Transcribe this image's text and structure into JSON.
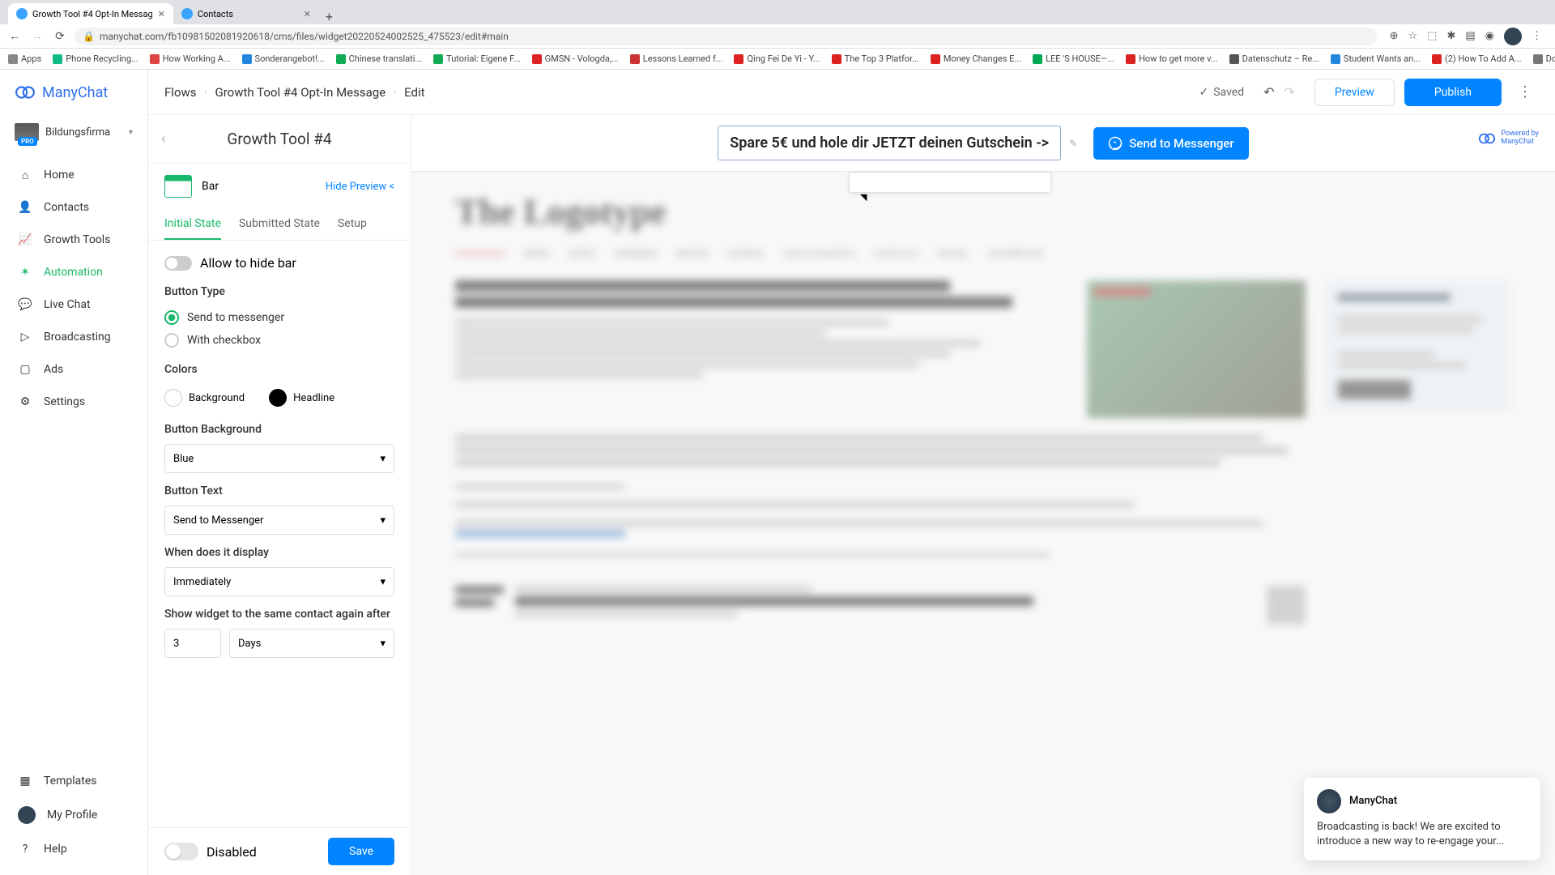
{
  "browser": {
    "tabs": [
      {
        "title": "Growth Tool #4 Opt-In Messag"
      },
      {
        "title": "Contacts"
      }
    ],
    "url": "manychat.com/fb10981502081920618/cms/files/widget20220524002525_475523/edit#main",
    "bookmarks": [
      "Apps",
      "Phone Recycling...",
      "How Working A...",
      "Sonderangebot!...",
      "Chinese translati...",
      "Tutorial: Eigene F...",
      "GMSN - Vologda,...",
      "Lessons Learned f...",
      "Qing Fei De Yi - Y...",
      "The Top 3 Platfor...",
      "Money Changes E...",
      "LEE 'S HOUSE—...",
      "How to get more v...",
      "Datenschutz – Re...",
      "Student Wants an...",
      "(2) How To Add A...",
      "Download - Cooki..."
    ]
  },
  "app": {
    "brand": "ManyChat",
    "org": {
      "name": "Bildungsfirma",
      "badge": "PRO"
    },
    "nav": [
      "Home",
      "Contacts",
      "Growth Tools",
      "Automation",
      "Live Chat",
      "Broadcasting",
      "Ads",
      "Settings"
    ],
    "navBottom": [
      "Templates",
      "My Profile",
      "Help"
    ]
  },
  "breadcrumbs": [
    "Flows",
    "Growth Tool #4 Opt-In Message",
    "Edit"
  ],
  "topbar": {
    "saved": "Saved",
    "preview": "Preview",
    "publish": "Publish"
  },
  "panel": {
    "title": "Growth Tool #4",
    "barLabel": "Bar",
    "hidePreview": "Hide Preview <",
    "tabs": [
      "Initial State",
      "Submitted State",
      "Setup"
    ],
    "allowHide": "Allow to hide bar",
    "buttonType": {
      "title": "Button Type",
      "opts": [
        "Send to messenger",
        "With checkbox"
      ]
    },
    "colors": {
      "title": "Colors",
      "bg": "Background",
      "hl": "Headline"
    },
    "buttonBg": {
      "title": "Button Background",
      "value": "Blue"
    },
    "buttonText": {
      "title": "Button Text",
      "value": "Send to Messenger"
    },
    "whenDisplay": {
      "title": "When does it display",
      "value": "Immediately"
    },
    "showAgain": {
      "title": "Show widget to the same contact again after",
      "num": "3",
      "unit": "Days"
    },
    "disabled": "Disabled",
    "save": "Save"
  },
  "previewBar": {
    "text": "Spare 5€ und hole dir JETZT deinen Gutschein ->",
    "button": "Send to Messenger",
    "powered": "Powered by\nManyChat"
  },
  "blurSite": {
    "masthead": "The Logotype",
    "nav": [
      "FRONTPAGE",
      "NEWS",
      "SPORT",
      "BUSINESS",
      "MOVIES",
      "SCIENCE",
      "TECH & GADGETS",
      "LIFESTYLE",
      "TRAVEL",
      "AUTOMOTIVE"
    ]
  },
  "chat": {
    "name": "ManyChat",
    "msg": "Broadcasting is back! We are excited to introduce a new way to re-engage your..."
  }
}
